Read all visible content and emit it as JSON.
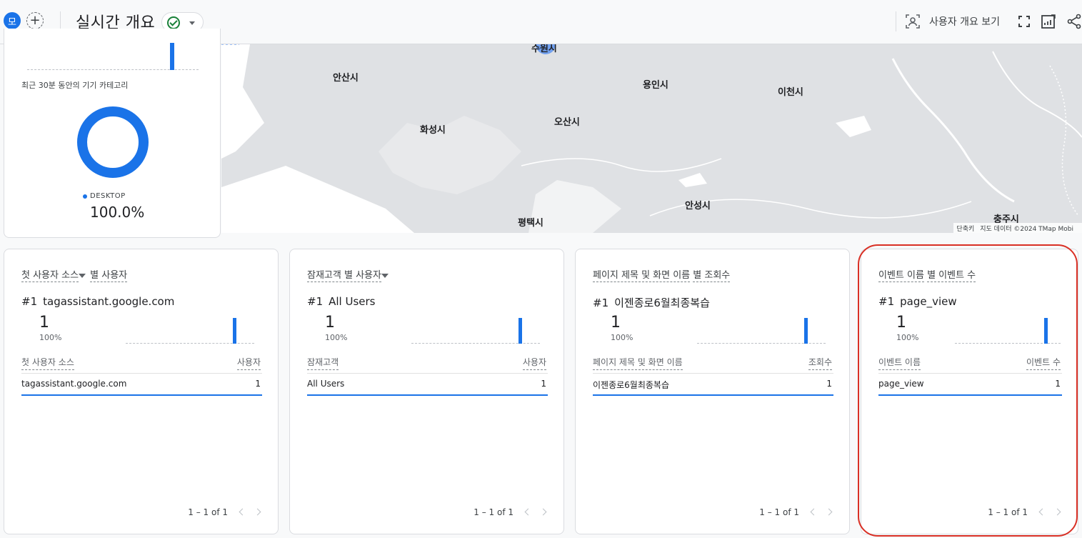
{
  "header": {
    "avatar_initial": "모",
    "add_symbol": "+",
    "title": "실시간 개요",
    "overview_link": "사용자 개요 보기",
    "icons": [
      "user-snapshot-icon",
      "fullscreen-icon",
      "edit-chart-icon",
      "share-icon"
    ]
  },
  "map": {
    "cities": [
      "안산시",
      "용인시",
      "이천시",
      "화성시",
      "오산시",
      "안성시",
      "평택시",
      "충주시",
      "수원시"
    ],
    "attribution_shortcuts": "단축키",
    "attribution_data": "지도 데이터 ©2024 TMap Mobi"
  },
  "device": {
    "label": "최근 30분 동안의 기기 카테고리",
    "legend_name": "DESKTOP",
    "legend_value": "100.0%",
    "share": 1.0,
    "color": "#1a73e8"
  },
  "cards": [
    {
      "title_a": "첫 사용자 소스",
      "title_b": "별 사용자",
      "has_dropdown": true,
      "rank": "#1",
      "top_item": "tagassistant.google.com",
      "value": "1",
      "percent": "100%",
      "col_left": "첫 사용자 소스",
      "col_right": "사용자",
      "row_label": "tagassistant.google.com",
      "row_value": "1",
      "pager": "1 – 1 of 1"
    },
    {
      "title_a": "잠재고객 별 사용자",
      "title_b": "",
      "has_dropdown": true,
      "rank": "#1",
      "top_item": "All Users",
      "value": "1",
      "percent": "100%",
      "col_left": "잠재고객",
      "col_right": "사용자",
      "row_label": "All Users",
      "row_value": "1",
      "pager": "1 – 1 of 1"
    },
    {
      "title_a": "페이지 제목 및 화면 이름",
      "title_b": "별 조회수",
      "has_dropdown": false,
      "rank": "#1",
      "top_item": "이젠종로6월최종복습",
      "value": "1",
      "percent": "100%",
      "col_left": "페이지 제목 및 화면 이름",
      "col_right": "조회수",
      "row_label": "이젠종로6월최종복습",
      "row_value": "1",
      "pager": "1 – 1 of 1"
    },
    {
      "title_a": "이벤트 이름",
      "title_b": "별 이벤트 수",
      "has_dropdown": false,
      "rank": "#1",
      "top_item": "page_view",
      "value": "1",
      "percent": "100%",
      "col_left": "이벤트 이름",
      "col_right": "이벤트 수",
      "row_label": "page_view",
      "row_value": "1",
      "pager": "1 – 1 of 1"
    }
  ],
  "colors": {
    "accent": "#1a73e8",
    "success": "#188038",
    "highlight": "#d93025"
  }
}
